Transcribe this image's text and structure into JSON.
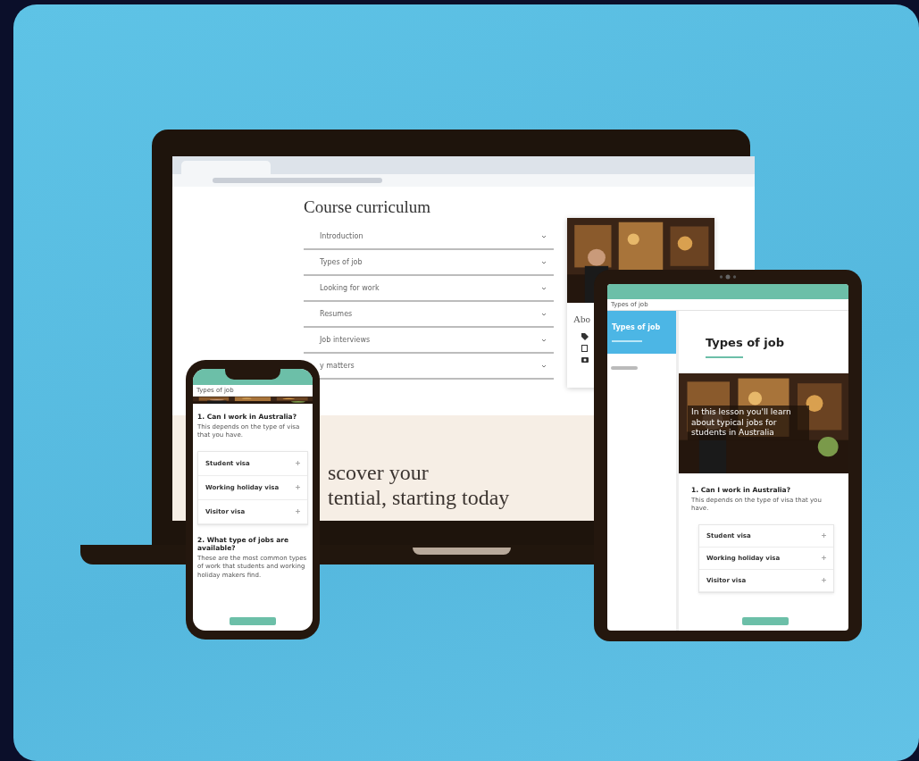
{
  "laptop": {
    "heading": "Course curriculum",
    "modules": [
      {
        "title": "Introduction"
      },
      {
        "title": "Types of job"
      },
      {
        "title": "Looking for work"
      },
      {
        "title": "Resumes"
      },
      {
        "title": "Job interviews"
      },
      {
        "title": "y matters"
      }
    ],
    "about_title": "Abo",
    "banner_lines": [
      "scover your",
      "tential, starting today"
    ]
  },
  "phone": {
    "breadcrumb": "Types of job",
    "sections": [
      {
        "title": "1. Can I work in Australia?",
        "text": "This depends on the type of visa that you have.",
        "items": [
          "Student visa",
          "Working holiday visa",
          "Visitor visa"
        ]
      },
      {
        "title": "2. What type of jobs are available?",
        "text": "These are the most common types of work that students and working holiday makers find."
      }
    ]
  },
  "tablet": {
    "breadcrumb": "Types of job",
    "sidebar_title": "Types of job",
    "title": "Types of job",
    "hero_text": "In this lesson you'll learn about typical jobs for students in Australia",
    "question": "1. Can I work in Australia?",
    "text": "This depends on the type of visa that you have.",
    "items": [
      "Student visa",
      "Working holiday visa",
      "Visitor visa"
    ]
  }
}
